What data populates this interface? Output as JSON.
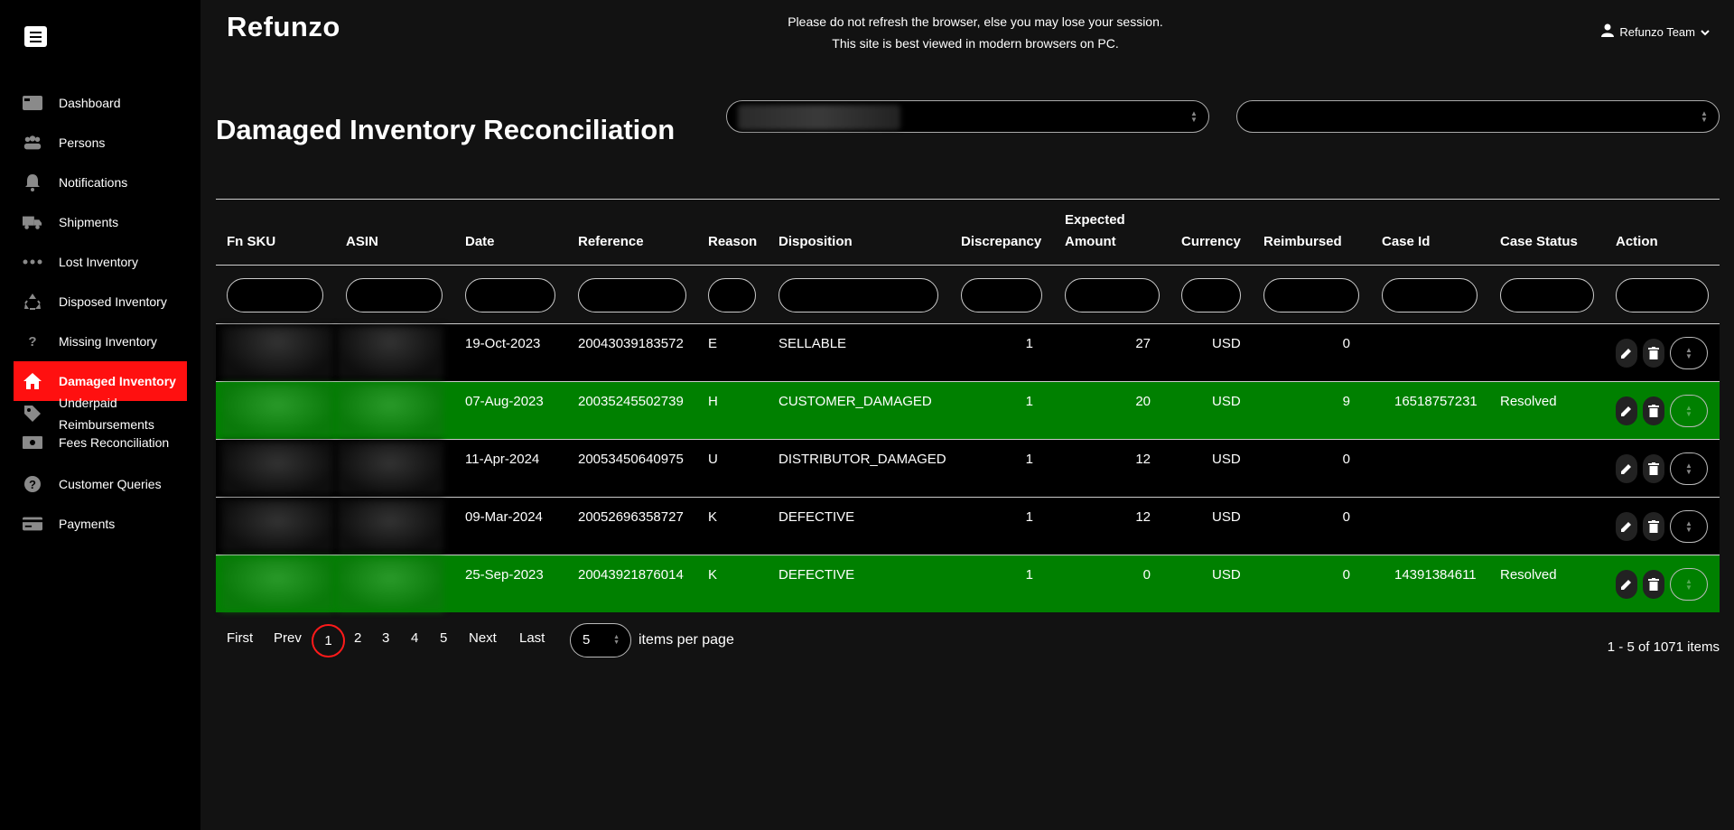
{
  "brand": "Refunzo",
  "notice": {
    "line1": "Please do not refresh the browser, else you may lose your session.",
    "line2": "This site is best viewed in modern browsers on PC."
  },
  "user": {
    "name": "Refunzo Team"
  },
  "sidebar": {
    "items": [
      {
        "label": "Dashboard",
        "icon": "dashboard-icon"
      },
      {
        "label": "Persons",
        "icon": "persons-icon"
      },
      {
        "label": "Notifications",
        "icon": "bell-icon"
      },
      {
        "label": "Shipments",
        "icon": "truck-icon"
      },
      {
        "label": "Lost Inventory",
        "icon": "dots-icon"
      },
      {
        "label": "Disposed Inventory",
        "icon": "recycle-icon"
      },
      {
        "label": "Missing Inventory",
        "icon": "question-icon"
      },
      {
        "label": "Damaged Inventory",
        "icon": "home-icon",
        "active": true
      },
      {
        "label": "Underpaid Reimbursements",
        "icon": "tag-icon"
      },
      {
        "label": "Fees Reconciliation",
        "icon": "money-icon"
      },
      {
        "label": "Customer Queries",
        "icon": "question-circle-icon"
      },
      {
        "label": "Payments",
        "icon": "card-icon"
      }
    ]
  },
  "page": {
    "title": "Damaged Inventory Reconciliation"
  },
  "table": {
    "headers": {
      "fnsku": "Fn SKU",
      "asin": "ASIN",
      "date": "Date",
      "reference": "Reference",
      "reason": "Reason",
      "disposition": "Disposition",
      "discrepancy": "Discrepancy",
      "expected_amount_l1": "Expected",
      "expected_amount_l2": "Amount",
      "currency": "Currency",
      "reimbursed": "Reimbursed",
      "case_id": "Case Id",
      "case_status": "Case Status",
      "action": "Action"
    },
    "rows": [
      {
        "date": "19-Oct-2023",
        "reference": "20043039183572",
        "reason": "E",
        "disposition": "SELLABLE",
        "discrepancy": "1",
        "expected": "27",
        "currency": "USD",
        "reimbursed": "0",
        "case_id": "",
        "case_status": "",
        "highlight": false
      },
      {
        "date": "07-Aug-2023",
        "reference": "20035245502739",
        "reason": "H",
        "disposition": "CUSTOMER_DAMAGED",
        "discrepancy": "1",
        "expected": "20",
        "currency": "USD",
        "reimbursed": "9",
        "case_id": "16518757231",
        "case_status": "Resolved",
        "highlight": true
      },
      {
        "date": "11-Apr-2024",
        "reference": "20053450640975",
        "reason": "U",
        "disposition": "DISTRIBUTOR_DAMAGED",
        "discrepancy": "1",
        "expected": "12",
        "currency": "USD",
        "reimbursed": "0",
        "case_id": "",
        "case_status": "",
        "highlight": false
      },
      {
        "date": "09-Mar-2024",
        "reference": "20052696358727",
        "reason": "K",
        "disposition": "DEFECTIVE",
        "discrepancy": "1",
        "expected": "12",
        "currency": "USD",
        "reimbursed": "0",
        "case_id": "",
        "case_status": "",
        "highlight": false
      },
      {
        "date": "25-Sep-2023",
        "reference": "20043921876014",
        "reason": "K",
        "disposition": "DEFECTIVE",
        "discrepancy": "1",
        "expected": "0",
        "currency": "USD",
        "reimbursed": "0",
        "case_id": "14391384611",
        "case_status": "Resolved",
        "highlight": true
      }
    ]
  },
  "pagination": {
    "first": "First",
    "prev": "Prev",
    "pages": [
      "1",
      "2",
      "3",
      "4",
      "5"
    ],
    "current": "1",
    "next": "Next",
    "last": "Last",
    "per_page": "5",
    "per_page_label": "items per page",
    "summary": "1 - 5 of 1071 items"
  },
  "colors": {
    "active_nav": "#ff1010",
    "resolved_row": "#008000",
    "page_ring": "#ff1a1a"
  }
}
